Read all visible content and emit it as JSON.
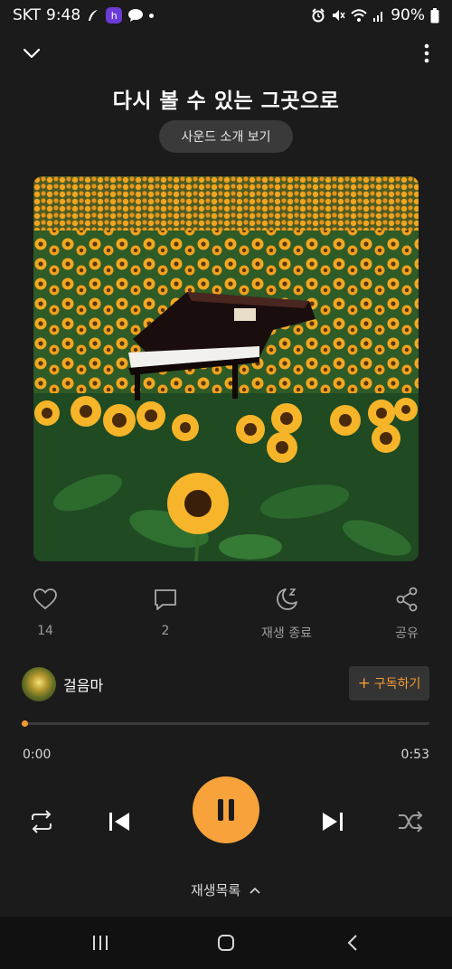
{
  "status_bar": {
    "carrier": "SKT",
    "time": "9:48",
    "battery": "90%",
    "icons": [
      "alarm-icon",
      "mute-icon",
      "wifi-icon",
      "signal-icon",
      "battery-icon"
    ]
  },
  "header": {
    "collapse_icon": "chevron-down-icon",
    "more_icon": "more-vertical-icon"
  },
  "track": {
    "title": "다시 볼 수 있는 그곳으로",
    "intro_button": "사운드 소개 보기"
  },
  "actions": {
    "like_count": "14",
    "comment_count": "2",
    "sleep_label": "재생 종료",
    "share_label": "공유"
  },
  "creator": {
    "name": "걸음마",
    "subscribe_label": "구독하기",
    "subscribe_plus": "+"
  },
  "player": {
    "current_time": "0:00",
    "duration": "0:53",
    "progress": 0.005,
    "playlist_label": "재생목록"
  },
  "colors": {
    "accent": "#f59b35",
    "background": "#1b1b1b"
  }
}
